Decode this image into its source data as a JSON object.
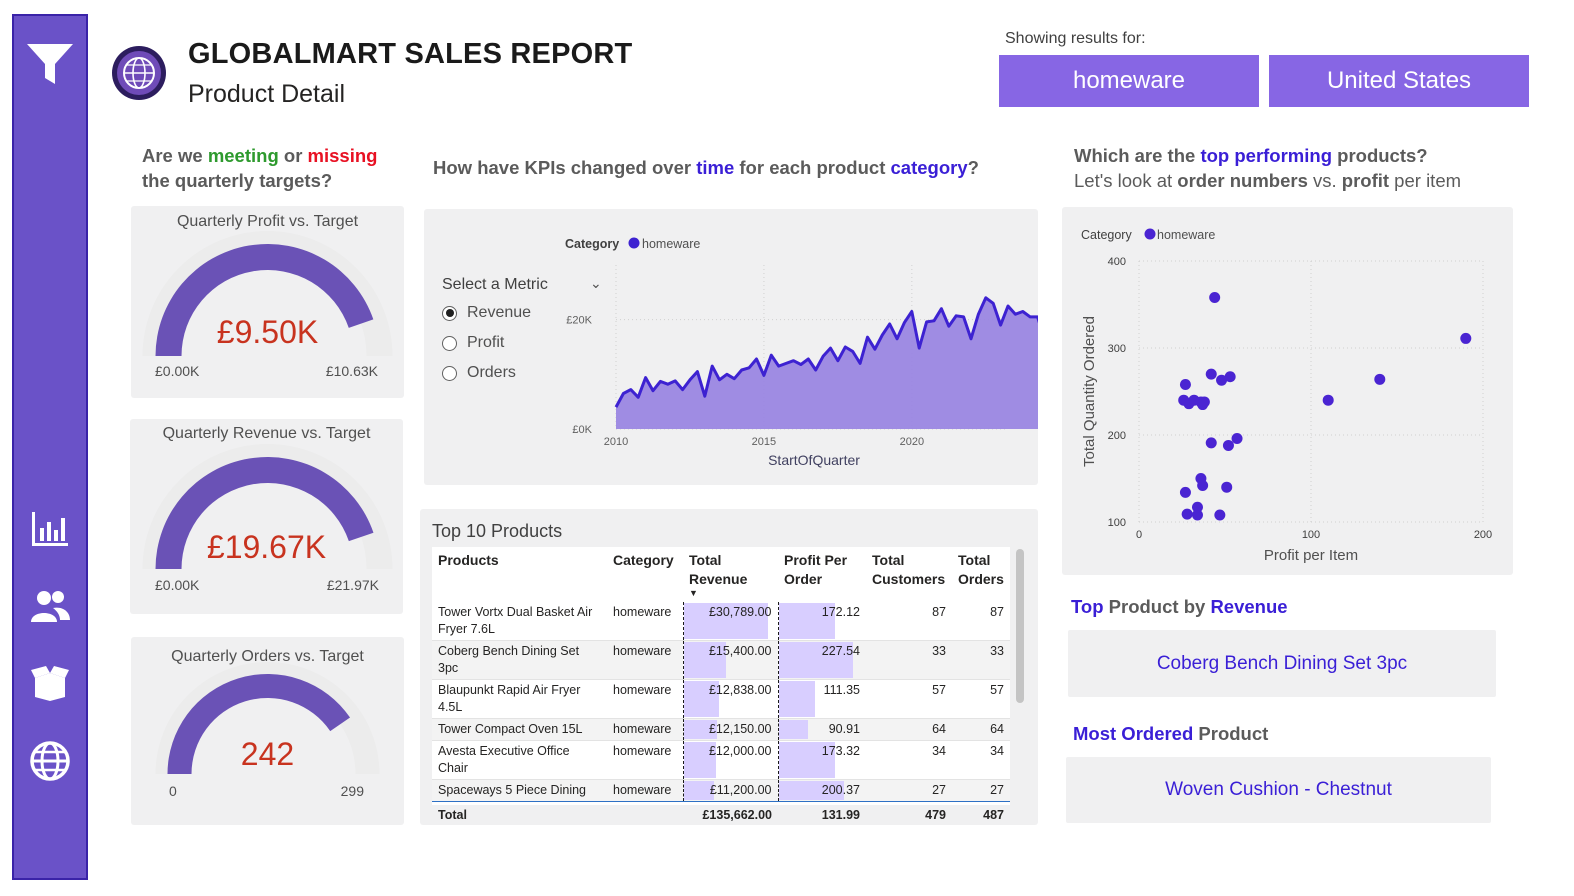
{
  "header": {
    "title": "GLOBALMART SALES REPORT",
    "subtitle": "Product Detail",
    "showing_label": "Showing results for:",
    "filter_category": "homeware",
    "filter_country": "United States"
  },
  "sidebar": {
    "icons": [
      "filter-icon",
      "bar-chart-icon",
      "people-icon",
      "box-icon",
      "globe-icon"
    ]
  },
  "targets": {
    "heading_1": "Are we ",
    "heading_meeting": "meeting",
    "heading_or": " or ",
    "heading_missing": "missing",
    "heading_2": "the quarterly targets?",
    "gauges": [
      {
        "title": "Quarterly Profit vs. Target",
        "value": "£9.50K",
        "min": "£0.00K",
        "max": "£10.63K",
        "fraction": 0.894
      },
      {
        "title": "Quarterly Revenue vs. Target",
        "value": "£19.67K",
        "min": "£0.00K",
        "max": "£21.97K",
        "fraction": 0.895
      },
      {
        "title": "Quarterly Orders vs. Target",
        "value": "242",
        "min": "0",
        "max": "299",
        "fraction": 0.809
      }
    ]
  },
  "kpi": {
    "heading_1": "How have KPIs changed over ",
    "heading_time": "time",
    "heading_2": " for each product ",
    "heading_category": "category",
    "heading_3": "?",
    "select_label": "Select a Metric",
    "metrics": [
      "Revenue",
      "Profit",
      "Orders"
    ],
    "selected_metric": "Revenue"
  },
  "chart_data": [
    {
      "type": "area",
      "legend_title": "Category",
      "series": [
        {
          "name": "homeware",
          "color": "#3d22d1",
          "values": [
            4000,
            6500,
            7200,
            5800,
            9400,
            7000,
            8700,
            8200,
            8800,
            7200,
            9000,
            10500,
            6000,
            11500,
            9000,
            10000,
            9200,
            10800,
            11200,
            12800,
            9800,
            13500,
            11500,
            12000,
            12500,
            11800,
            12800,
            10800,
            13300,
            14800,
            12500,
            15000,
            14200,
            12000,
            16800,
            14600,
            17200,
            19200,
            16500,
            19500,
            21500,
            14800,
            19600,
            19800,
            22000,
            18800,
            20700,
            20500,
            16500,
            21000,
            24000,
            23000,
            19000,
            22500,
            21000,
            21500,
            20500,
            20500,
            16000,
            23500,
            22000,
            19000,
            23500,
            22500,
            24000,
            20800,
            25500,
            24300,
            23800,
            27000,
            30000,
            23800,
            23000,
            23000
          ]
        }
      ],
      "x_start": 2010,
      "x_end": 2023.25,
      "x_ticks": [
        "2010",
        "2015",
        "2020"
      ],
      "y_ticks": [
        "£0K",
        "£20K"
      ],
      "ylim": [
        0,
        30000
      ],
      "xlabel": "StartOfQuarter",
      "grid": true
    },
    {
      "type": "scatter",
      "legend_title": "Category",
      "series": [
        {
          "name": "homeware",
          "color": "#4a24d2",
          "points": [
            [
              44,
              358
            ],
            [
              190,
              311
            ],
            [
              140,
              264
            ],
            [
              42,
              270
            ],
            [
              53,
              267
            ],
            [
              48,
              263
            ],
            [
              27,
              258
            ],
            [
              110,
              240
            ],
            [
              26,
              240
            ],
            [
              32,
              240
            ],
            [
              29,
              236
            ],
            [
              36,
              238
            ],
            [
              38,
              238
            ],
            [
              37,
              235
            ],
            [
              57,
              196
            ],
            [
              42,
              191
            ],
            [
              52,
              188
            ],
            [
              36,
              150
            ],
            [
              51,
              140
            ],
            [
              37,
              142
            ],
            [
              27,
              134
            ],
            [
              34,
              117
            ],
            [
              34,
              108
            ],
            [
              28,
              109
            ],
            [
              47,
              108
            ]
          ]
        }
      ],
      "xlabel": "Profit per Item",
      "ylabel": "Total Quantity Ordered",
      "xlim": [
        0,
        200
      ],
      "ylim": [
        100,
        400
      ],
      "x_ticks": [
        "0",
        "100",
        "200"
      ],
      "y_ticks": [
        "100",
        "200",
        "300",
        "400"
      ],
      "grid": true
    }
  ],
  "top10": {
    "title": "Top 10 Products",
    "columns": [
      "Products",
      "Category",
      "Total Revenue",
      "Profit Per Order",
      "Total Customers",
      "Total Orders"
    ],
    "rows": [
      {
        "product": "Tower Vortx Dual Basket Air Fryer 7.6L",
        "category": "homeware",
        "revenue": "£30,789.00",
        "revenue_num": 30789,
        "ppo": "172.12",
        "ppo_num": 172.12,
        "customers": "87",
        "orders": "87"
      },
      {
        "product": "Coberg Bench Dining Set 3pc",
        "category": "homeware",
        "revenue": "£15,400.00",
        "revenue_num": 15400,
        "ppo": "227.54",
        "ppo_num": 227.54,
        "customers": "33",
        "orders": "33"
      },
      {
        "product": "Blaupunkt Rapid Air Fryer 4.5L",
        "category": "homeware",
        "revenue": "£12,838.00",
        "revenue_num": 12838,
        "ppo": "111.35",
        "ppo_num": 111.35,
        "customers": "57",
        "orders": "57"
      },
      {
        "product": "Tower Compact Oven 15L",
        "category": "homeware",
        "revenue": "£12,150.00",
        "revenue_num": 12150,
        "ppo": "90.91",
        "ppo_num": 90.91,
        "customers": "64",
        "orders": "64"
      },
      {
        "product": "Avesta Executive Office Chair",
        "category": "homeware",
        "revenue": "£12,000.00",
        "revenue_num": 12000,
        "ppo": "173.32",
        "ppo_num": 173.32,
        "customers": "34",
        "orders": "34"
      },
      {
        "product": "Spaceways 5 Piece Dining",
        "category": "homeware",
        "revenue": "£11,200.00",
        "revenue_num": 11200,
        "ppo": "200.37",
        "ppo_num": 200.37,
        "customers": "27",
        "orders": "27"
      }
    ],
    "total": {
      "label": "Total",
      "revenue": "£135,662.00",
      "ppo": "131.99",
      "customers": "479",
      "orders": "487"
    }
  },
  "top_products": {
    "heading_1": "Which are the ",
    "heading_top": "top performing",
    "heading_2": " products?",
    "sub_1": "Let's look at ",
    "sub_orders": "order numbers",
    "sub_vs": " vs. ",
    "sub_profit": "profit",
    "sub_2": " per item",
    "by_revenue_top": "Top",
    "by_revenue_mid": " Product by ",
    "by_revenue_rev": "Revenue",
    "by_revenue_value": "Coberg Bench Dining Set 3pc",
    "most_ordered_a": "Most Ordered",
    "most_ordered_b": " Product",
    "most_ordered_value": "Woven Cushion - Chestnut"
  }
}
